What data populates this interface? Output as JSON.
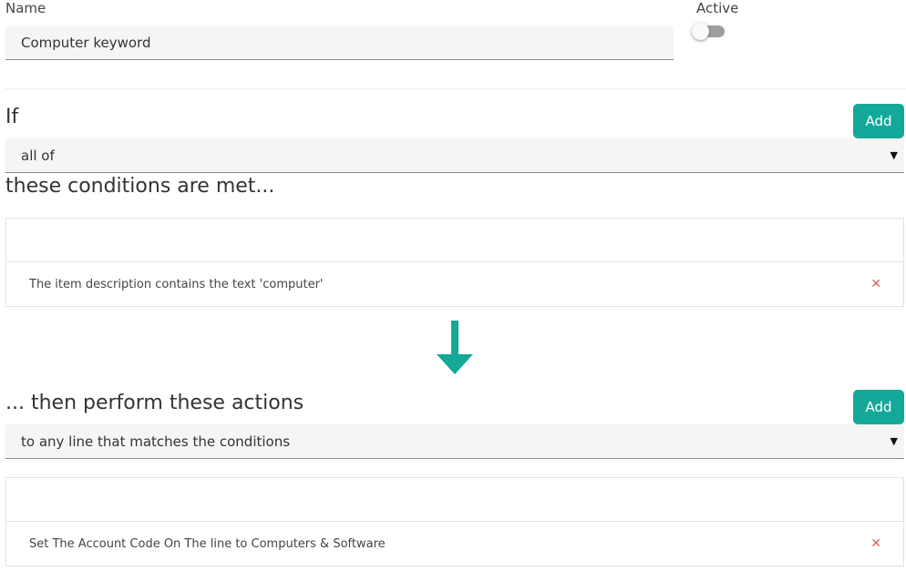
{
  "form": {
    "name_label": "Name",
    "name_value": "Computer keyword",
    "active_label": "Active",
    "active": false
  },
  "conditions": {
    "if_label": "If",
    "add_label": "Add",
    "match_value": "all of",
    "met_label": "these conditions are met...",
    "items": [
      {
        "text": "The item description contains the text 'computer'"
      }
    ]
  },
  "actions": {
    "then_label": "... then perform these actions",
    "add_label": "Add",
    "scope_value": "to any line that matches the conditions",
    "items": [
      {
        "text": "Set The Account Code On The line to Computers & Software"
      }
    ]
  },
  "icons": {
    "dropdown": "caret-down-icon",
    "remove": "close-icon",
    "flow": "arrow-down-icon"
  },
  "colors": {
    "accent": "#14a899",
    "remove": "#e05a5a"
  }
}
